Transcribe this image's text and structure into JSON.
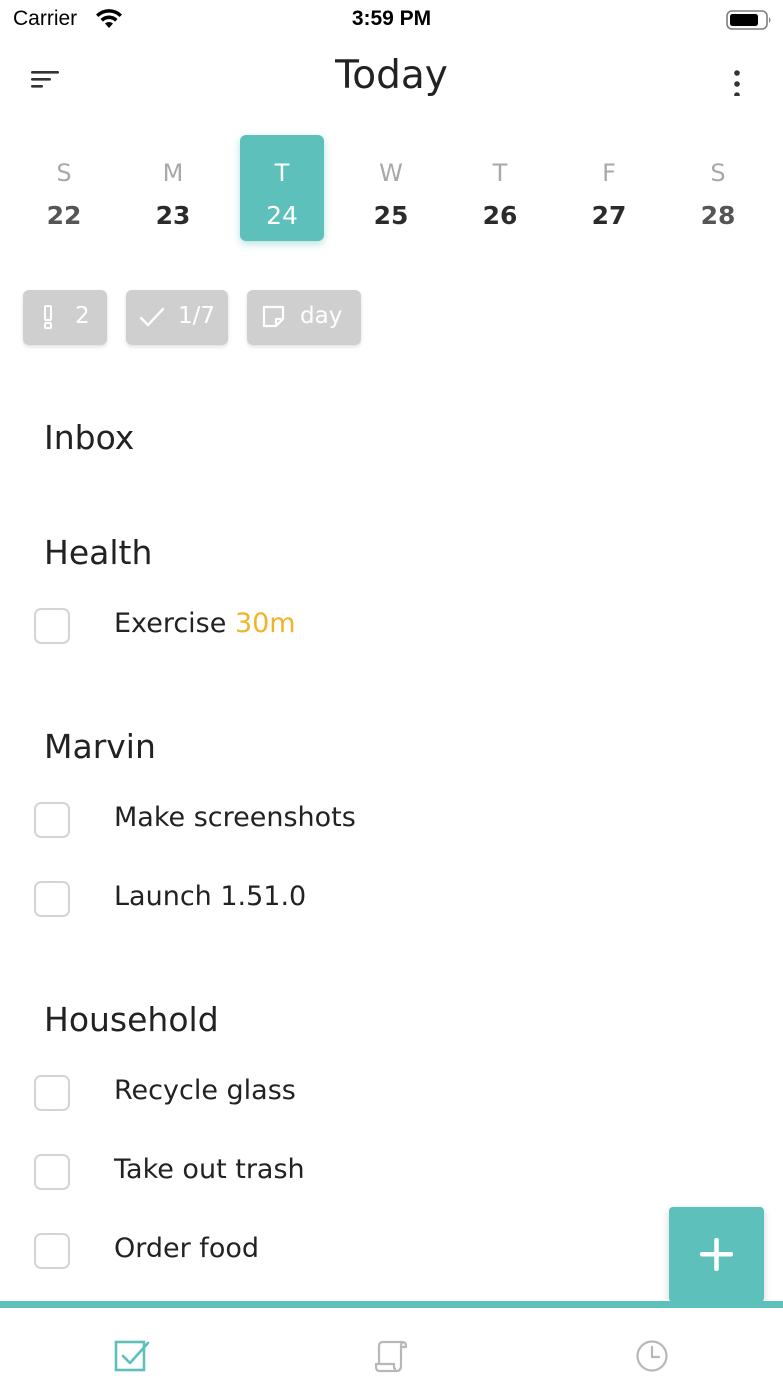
{
  "status_bar": {
    "carrier": "Carrier",
    "time": "3:59 PM"
  },
  "header": {
    "title": "Today",
    "left_icon": "sort-menu-icon",
    "right_icon": "more-vertical-icon"
  },
  "week": {
    "days": [
      {
        "dow": "S",
        "date": "22",
        "selected": false
      },
      {
        "dow": "M",
        "date": "23",
        "selected": false
      },
      {
        "dow": "T",
        "date": "24",
        "selected": true
      },
      {
        "dow": "W",
        "date": "25",
        "selected": false
      },
      {
        "dow": "T",
        "date": "26",
        "selected": false
      },
      {
        "dow": "F",
        "date": "27",
        "selected": false
      },
      {
        "dow": "S",
        "date": "28",
        "selected": false
      }
    ]
  },
  "chips": {
    "priority": {
      "icon": "exclamation-icon",
      "value": "2"
    },
    "progress": {
      "icon": "checkmark-icon",
      "value": "1/7"
    },
    "note": {
      "icon": "note-icon",
      "value": "day"
    }
  },
  "sections": {
    "inbox": {
      "title": "Inbox",
      "tasks": []
    },
    "health": {
      "title": "Health",
      "tasks": [
        {
          "label": "Exercise",
          "duration": "30m"
        }
      ]
    },
    "marvin": {
      "title": "Marvin",
      "tasks": [
        {
          "label": "Make screenshots"
        },
        {
          "label": "Launch 1.51.0"
        }
      ]
    },
    "household": {
      "title": "Household",
      "tasks": [
        {
          "label": "Recycle glass"
        },
        {
          "label": "Take out trash"
        },
        {
          "label": "Order food"
        }
      ]
    }
  },
  "fab": {
    "icon": "plus-icon"
  },
  "tabs": [
    {
      "icon": "checkbox-tasks-icon",
      "active": true
    },
    {
      "icon": "scroll-notes-icon",
      "active": false
    },
    {
      "icon": "clock-icon",
      "active": false
    }
  ],
  "colors": {
    "accent": "#5dc0ba",
    "duration": "#f0b429",
    "chip_bg": "#cfcfcf"
  }
}
